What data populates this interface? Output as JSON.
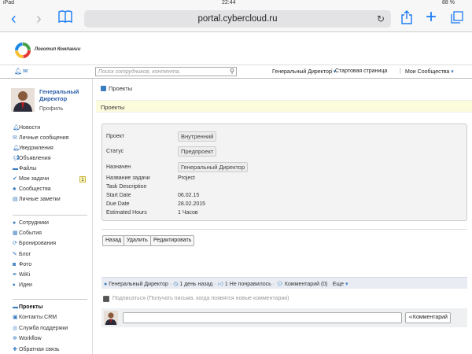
{
  "status": {
    "device": "iPad",
    "time": "22:44",
    "battery": "88 %"
  },
  "browser": {
    "url": "portal.cybercloud.ru"
  },
  "logo": {
    "text": "Логотип Компании"
  },
  "search": {
    "placeholder": "Поиск сотрудников, контента."
  },
  "toplinks": {
    "user": "Генеральный Директор",
    "start": "Стартовая страница",
    "communities": "Мои Сообщества"
  },
  "profile": {
    "name": "Генеральный Директор",
    "profile_link": "Профиль"
  },
  "nav1": [
    {
      "label": "Новости",
      "icon": "bell-icon"
    },
    {
      "label": "Личные сообщения",
      "icon": "mail-icon"
    },
    {
      "label": "Уведомления",
      "icon": "bell-icon"
    },
    {
      "label": "Объявления",
      "icon": "megaphone-icon"
    },
    {
      "label": "Файлы",
      "icon": "folder-icon"
    },
    {
      "label": "Мои задачи",
      "icon": "check-icon",
      "badge": "1"
    },
    {
      "label": "Сообщества",
      "icon": "sitemap-icon"
    },
    {
      "label": "Личные заметки",
      "icon": "note-icon"
    }
  ],
  "nav2": [
    {
      "label": "Сотрудники",
      "icon": "user-icon"
    },
    {
      "label": "События",
      "icon": "calendar-icon"
    },
    {
      "label": "Бронирования",
      "icon": "refresh-icon"
    },
    {
      "label": "Блог",
      "icon": "pencil-icon"
    },
    {
      "label": "Фото",
      "icon": "camera-icon"
    },
    {
      "label": "WiKi",
      "icon": "pen-icon"
    },
    {
      "label": "Идеи",
      "icon": "lightbulb-icon"
    }
  ],
  "nav3": [
    {
      "label": "Проекты",
      "icon": "folder-icon",
      "active": true
    },
    {
      "label": "Контакты CRM",
      "icon": "contacts-icon"
    },
    {
      "label": "Служба поддержки",
      "icon": "lifebuoy-icon"
    },
    {
      "label": "Workflow",
      "icon": "gear-icon"
    },
    {
      "label": "Обратная связь",
      "icon": "plus-icon"
    }
  ],
  "main": {
    "checkbox_label": "Проекты",
    "band_title": "Проекты",
    "details": {
      "project_label": "Проект",
      "project_value": "Внутренний",
      "status_label": "Статус",
      "status_value": "Предпроект",
      "assigned_label": "Назначен",
      "assigned_value": "Генеральный Директор",
      "task_name_label": "Название задачи",
      "task_name_value": "Project",
      "task_desc_label": "Task Description",
      "start_label": "Start Date",
      "start_value": "06.02.15",
      "due_label": "Due Date",
      "due_value": "28.02.2015",
      "hours_label": "Estimated Hours",
      "hours_value": "1 Часов"
    },
    "buttons": {
      "back": "Назад",
      "delete": "Удалить",
      "edit": "Редактировать"
    },
    "meta": {
      "author": "Генеральный Директор",
      "time": "1 день назад",
      "likes": "1 Не понравилось",
      "comments": "Комментарий (0)",
      "more": "Еще"
    },
    "subscribe": "Подписаться (Получать письма, когда появятся новые комментарии)",
    "comment_button": "Комментарий"
  },
  "colors": {
    "accent": "#1a7cf5",
    "link": "#2a5ea8",
    "band": "#fcfbdc",
    "meta_bar": "#e9edf3"
  }
}
